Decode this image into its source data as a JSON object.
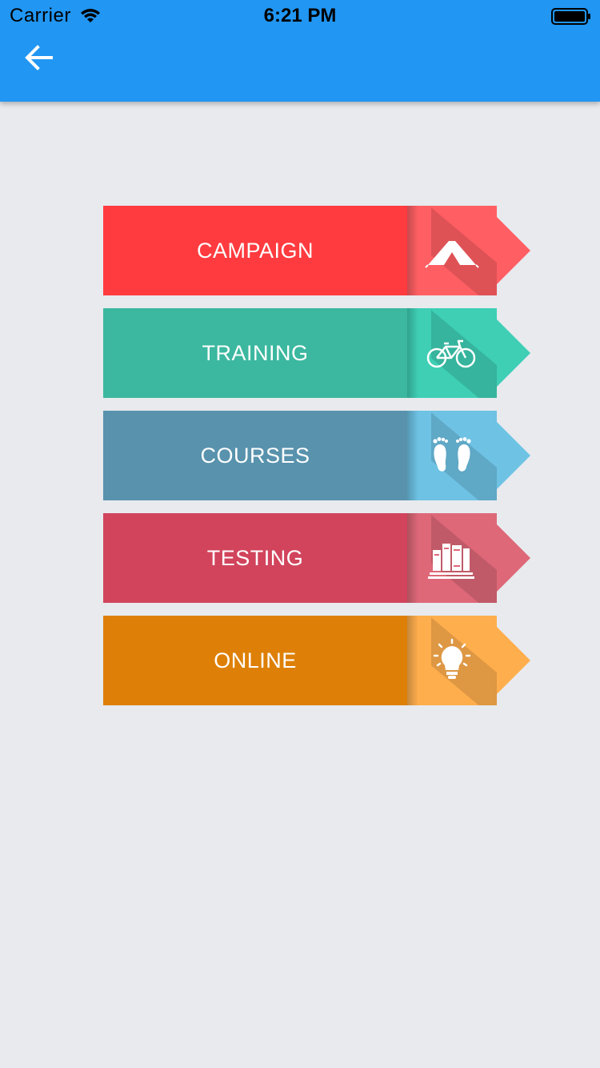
{
  "status_bar": {
    "carrier": "Carrier",
    "time": "6:21 PM",
    "wifi_icon": "wifi-icon",
    "battery_icon": "battery-icon"
  },
  "appbar": {
    "color": "#2196f3",
    "back_icon": "arrow-left-icon"
  },
  "menu": {
    "items": [
      {
        "label": "CAMPAIGN",
        "icon": "tent-icon",
        "main_color": "#ff3b3f",
        "tab_color": "#ff5f63"
      },
      {
        "label": "TRAINING",
        "icon": "bicycle-icon",
        "main_color": "#3bb89f",
        "tab_color": "#3ecfb5"
      },
      {
        "label": "COURSES",
        "icon": "footprints-icon",
        "main_color": "#5892ad",
        "tab_color": "#6ec2e4"
      },
      {
        "label": "TESTING",
        "icon": "books-icon",
        "main_color": "#d1445c",
        "tab_color": "#de6878"
      },
      {
        "label": "ONLINE",
        "icon": "lightbulb-icon",
        "main_color": "#de8007",
        "tab_color": "#ffae4d"
      }
    ]
  }
}
